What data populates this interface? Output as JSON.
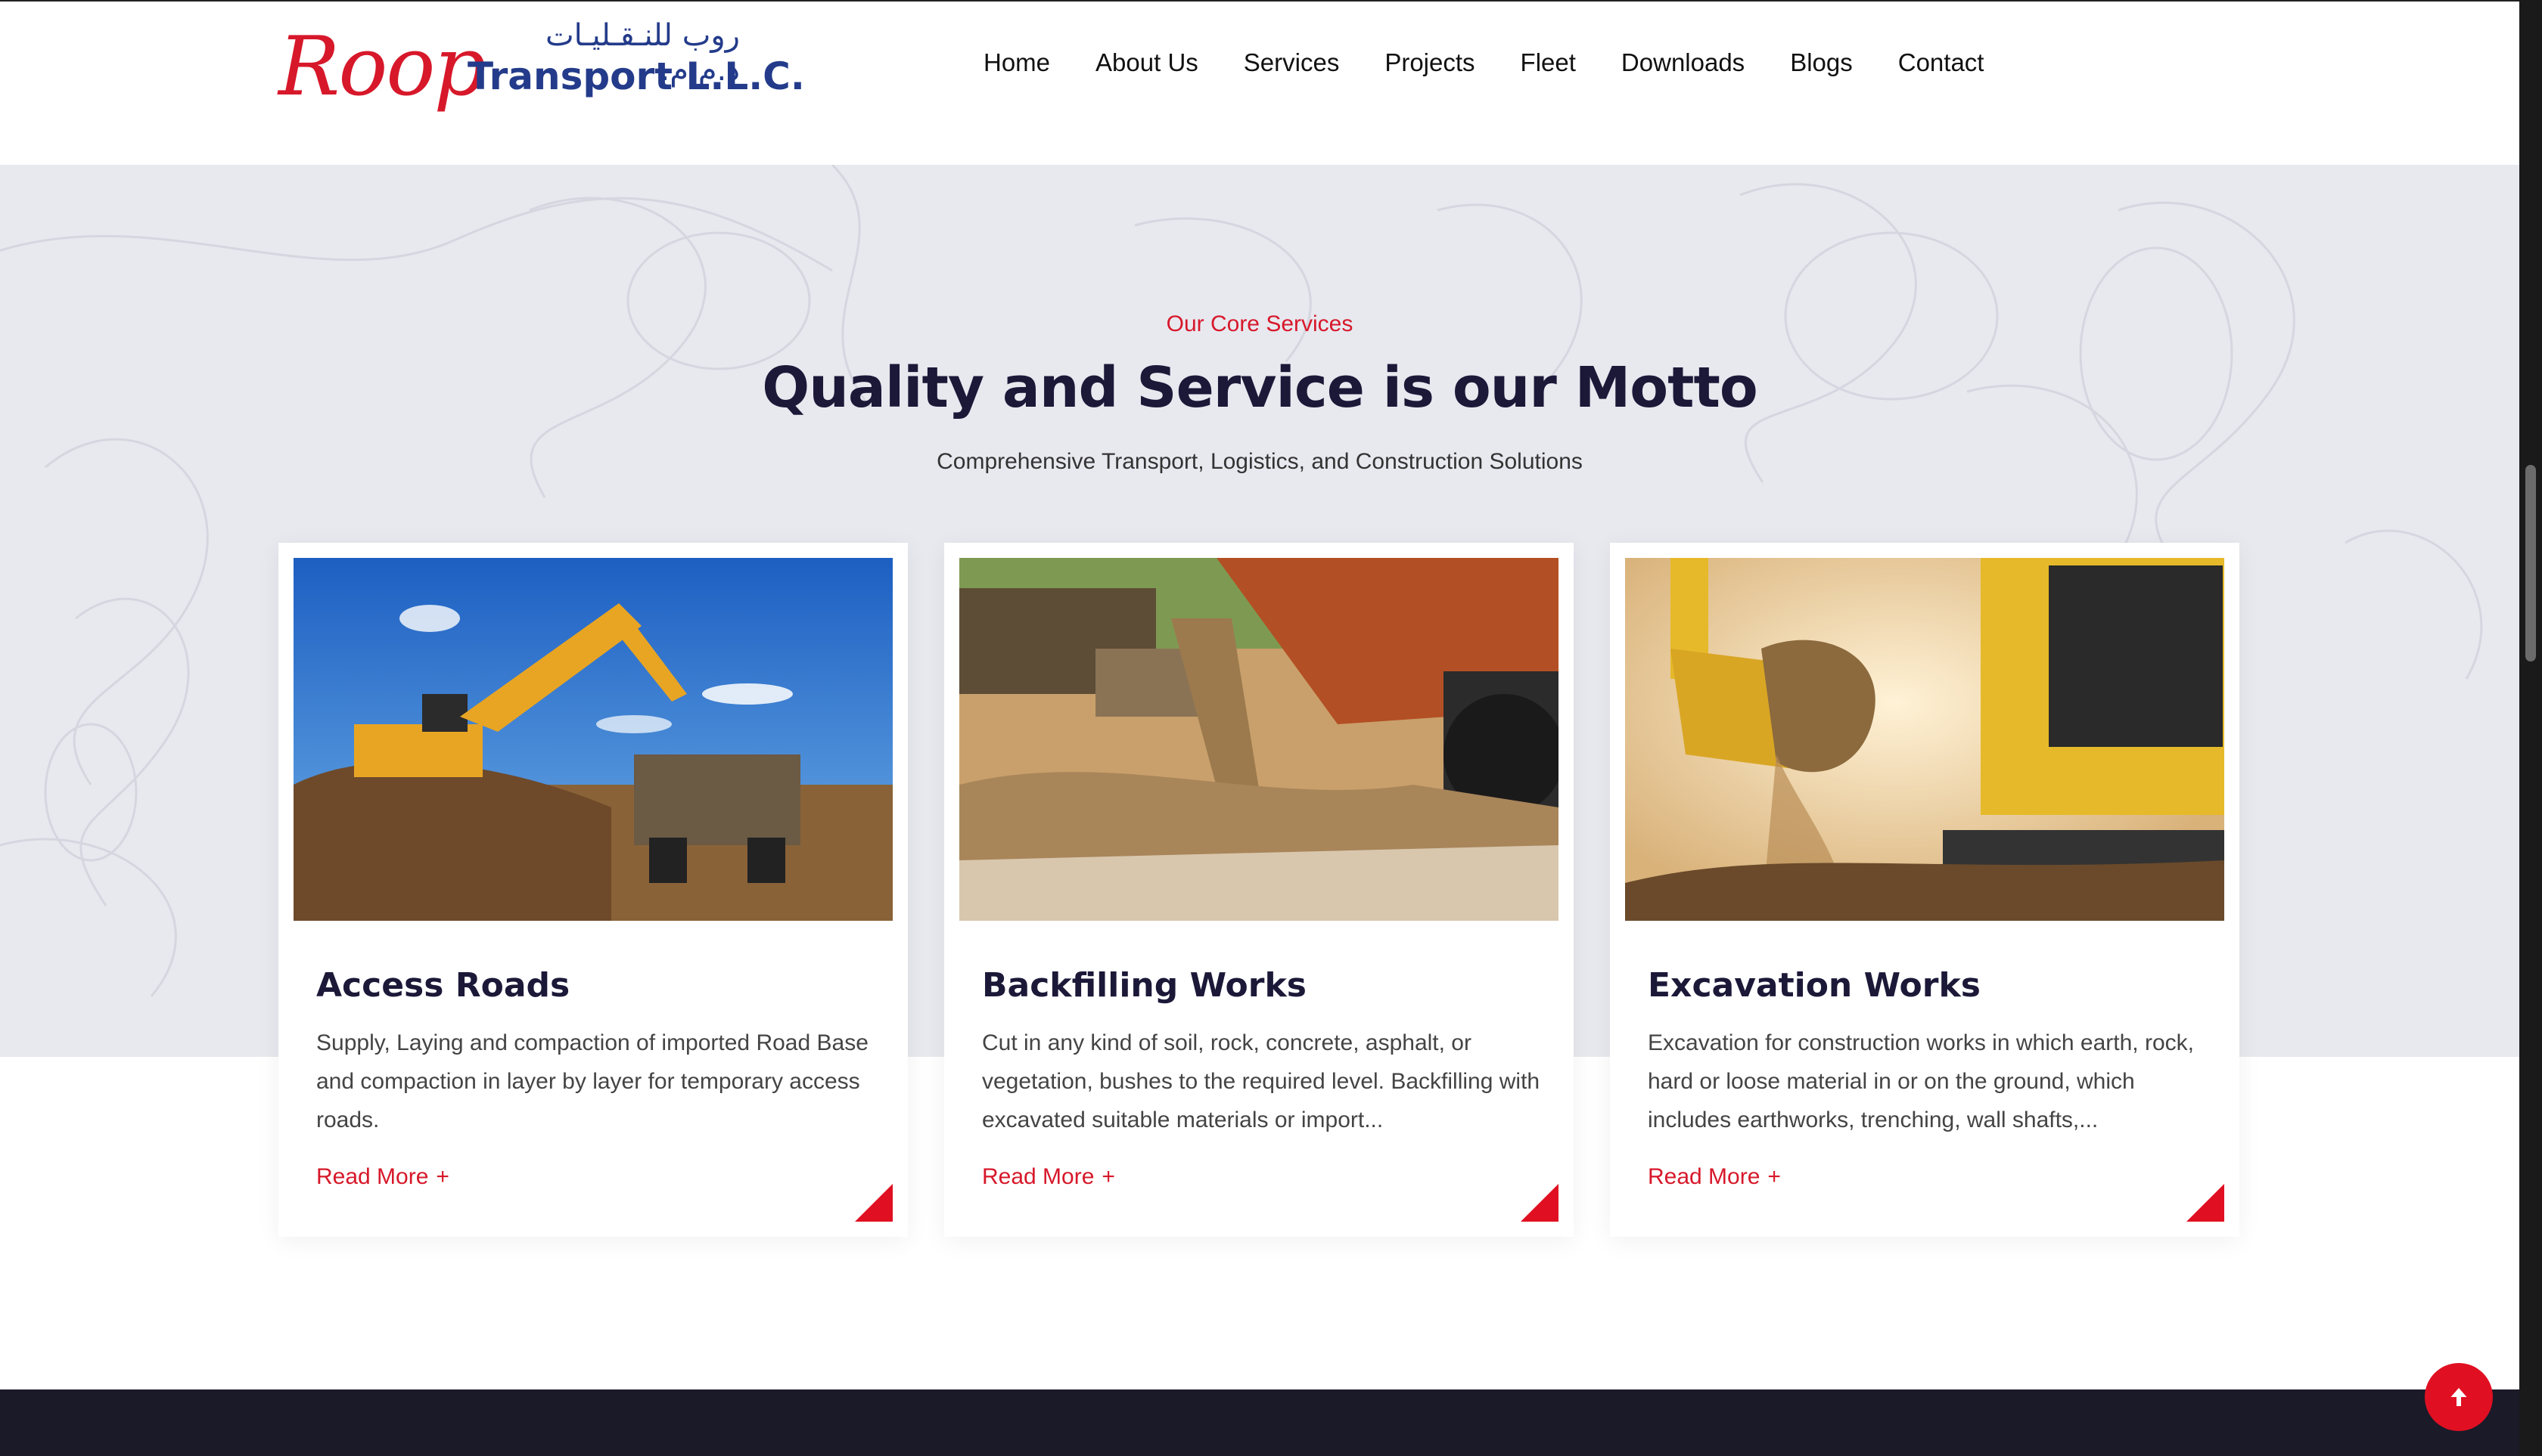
{
  "header": {
    "logo_script": "Roop",
    "logo_arabic": "روب للنـقـليـات ذ.م.م.",
    "logo_brand": "Transport L.L.C.",
    "nav": [
      "Home",
      "About Us",
      "Services",
      "Projects",
      "Fleet",
      "Downloads",
      "Blogs",
      "Contact"
    ]
  },
  "section": {
    "eyebrow": "Our Core Services",
    "headline": "Quality and Service is our Motto",
    "subline": "Comprehensive Transport, Logistics, and Construction Solutions"
  },
  "cards": [
    {
      "title": "Access Roads",
      "desc": "Supply, Laying and compaction of imported Road Base and compaction in layer by layer for temporary access roads.",
      "link": "Read More",
      "plus": "+"
    },
    {
      "title": "Backfilling Works",
      "desc": "Cut in any kind of soil, rock, concrete, asphalt, or vegetation, bushes to the required level. Backfilling with excavated suitable materials or import...",
      "link": "Read More",
      "plus": "+"
    },
    {
      "title": "Excavation Works",
      "desc": "Excavation for construction works in which earth, rock, hard or loose material in or on the ground, which includes earthworks, trenching, wall shafts,...",
      "link": "Read More",
      "plus": "+"
    }
  ],
  "colors": {
    "accent": "#d7182a",
    "heading": "#1b1838",
    "section_bg": "#e8e8ef"
  },
  "icons": {
    "scroll_top": "arrow-up-icon",
    "card_corner": "corner-triangle-icon"
  }
}
